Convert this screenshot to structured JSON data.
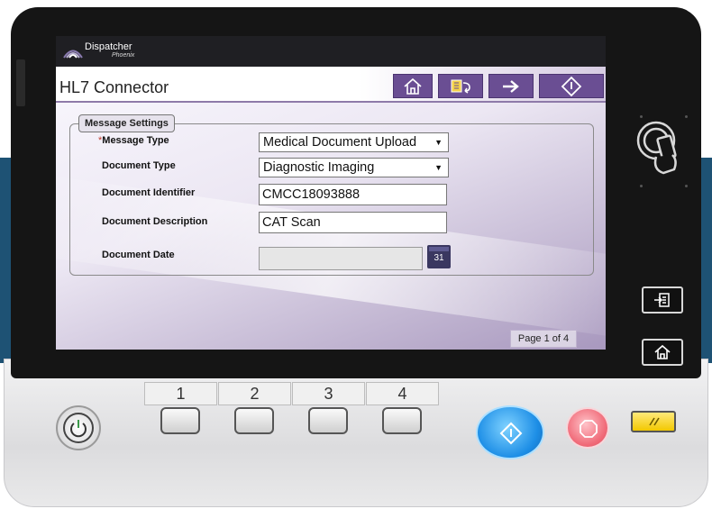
{
  "app": {
    "brand": "Dispatcher",
    "brand_sub": "Phoenix",
    "title": "HL7 Connector"
  },
  "toolbar": {
    "buttons": [
      {
        "name": "home",
        "icon": "home-icon"
      },
      {
        "name": "back",
        "icon": "back-icon"
      },
      {
        "name": "next",
        "icon": "arrow-right-icon"
      },
      {
        "name": "start",
        "icon": "start-diamond-icon"
      }
    ]
  },
  "form": {
    "section_title": "Message Settings",
    "required_marker": "*",
    "message_type": {
      "label": "Message Type",
      "value": "Medical Document Upload"
    },
    "document_type": {
      "label": "Document Type",
      "value": "Diagnostic Imaging"
    },
    "document_identifier": {
      "label": "Document Identifier",
      "value": "CMCC18093888"
    },
    "document_description": {
      "label": "Document Description",
      "value": "CAT Scan"
    },
    "document_date": {
      "label": "Document Date",
      "value": ""
    },
    "calendar_day": "31"
  },
  "pagination": {
    "text": "Page 1 of 4"
  },
  "hardware": {
    "number_tabs": [
      "1",
      "2",
      "3",
      "4"
    ]
  },
  "colors": {
    "accent": "#6a4e93",
    "start_key": "#1d8ee6",
    "stop_key": "#f06a78",
    "reset_key": "#f2c800",
    "band": "#1e5274"
  }
}
